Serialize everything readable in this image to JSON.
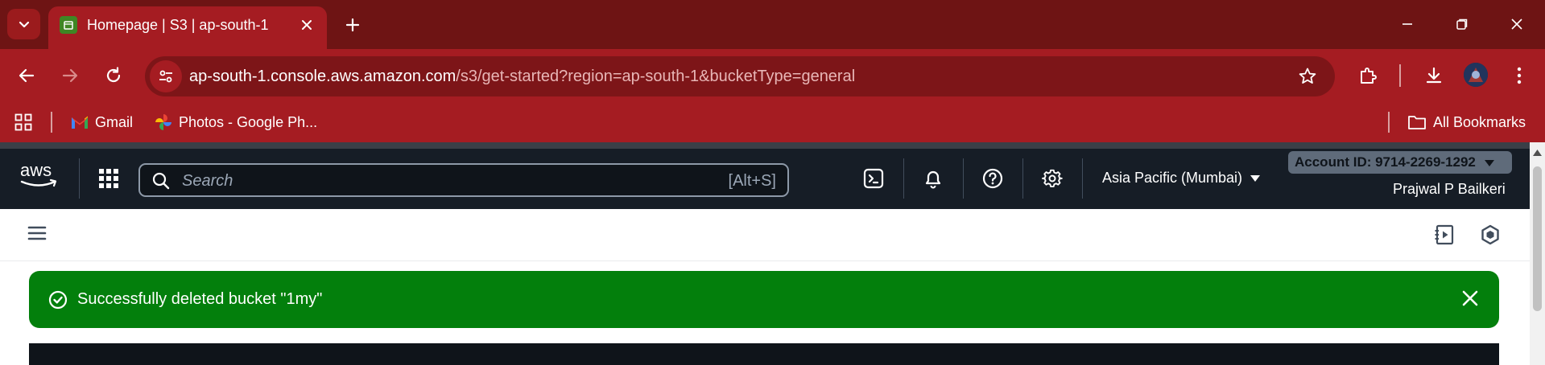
{
  "browser": {
    "tab_title": "Homepage | S3 | ap-south-1",
    "url_host": "ap-south-1.console.aws.amazon.com",
    "url_path": "/s3/get-started?region=ap-south-1&bucketType=general",
    "bookmarks": [
      {
        "label": "Gmail",
        "icon": "gmail-icon"
      },
      {
        "label": "Photos - Google Ph...",
        "icon": "google-photos-icon"
      }
    ],
    "all_bookmarks_label": "All Bookmarks",
    "theme_color": "#a51c22"
  },
  "aws_header": {
    "logo_text": "aws",
    "search_placeholder": "Search",
    "search_shortcut": "[Alt+S]",
    "region": "Asia Pacific (Mumbai)",
    "account_id": "Account ID: 9714-2269-1292",
    "username": "Prajwal P Bailkeri",
    "background_color": "#161d26"
  },
  "flash": {
    "message": "Successfully deleted bucket \"1my\"",
    "type": "success",
    "color": "#037f0c"
  }
}
